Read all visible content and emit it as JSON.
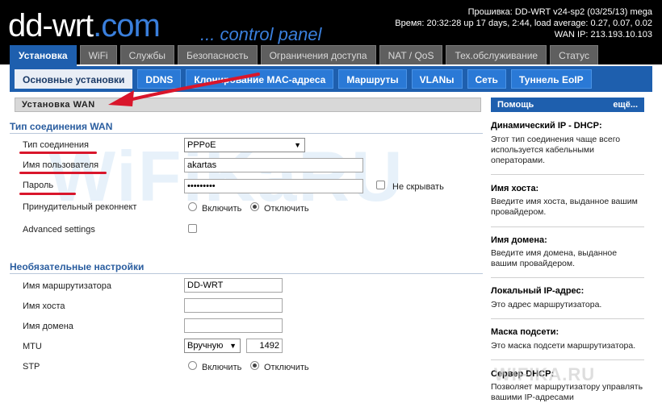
{
  "header": {
    "logo_main": "dd-wrt",
    "logo_dot": ".",
    "logo_tail": "com",
    "tagline": "... control panel",
    "firmware": "Прошивка: DD-WRT v24-sp2 (03/25/13) mega",
    "time": "Время: 20:32:28 up 17 days, 2:44, load average: 0.27, 0.07, 0.02",
    "wan_ip": "WAN IP: 213.193.10.103"
  },
  "tabs": [
    {
      "label": "Установка",
      "active": true
    },
    {
      "label": "WiFi"
    },
    {
      "label": "Службы"
    },
    {
      "label": "Безопасность"
    },
    {
      "label": "Ограничения доступа"
    },
    {
      "label": "NAT / QoS"
    },
    {
      "label": "Тех.обслуживание"
    },
    {
      "label": "Статус"
    }
  ],
  "subtabs": [
    {
      "label": "Основные установки",
      "active": true
    },
    {
      "label": "DDNS"
    },
    {
      "label": "Клонирование MAC-адреса"
    },
    {
      "label": "Маршруты"
    },
    {
      "label": "VLANы"
    },
    {
      "label": "Сеть"
    },
    {
      "label": "Туннель EoIP"
    }
  ],
  "section": {
    "title": "Установка WAN"
  },
  "wan": {
    "group_title": "Тип соединения WAN",
    "conn_type_label": "Тип соединения",
    "conn_type_value": "PPPoE",
    "username_label": "Имя пользователя",
    "username_value": "akartas",
    "password_label": "Пароль",
    "password_value": "•••••••••",
    "hide_label": "Не скрывать",
    "reconnect_label": "Принудительный реконнект",
    "enable_label": "Включить",
    "disable_label": "Отключить",
    "advanced_label": "Advanced settings"
  },
  "optional": {
    "group_title": "Необязательные настройки",
    "router_name_label": "Имя маршрутизатора",
    "router_name_value": "DD-WRT",
    "host_label": "Имя хоста",
    "host_value": "",
    "domain_label": "Имя домена",
    "domain_value": "",
    "mtu_label": "MTU",
    "mtu_mode": "Вручную",
    "mtu_value": "1492",
    "stp_label": "STP",
    "enable_label": "Включить",
    "disable_label": "Отключить"
  },
  "help": {
    "title": "Помощь",
    "more": "ещё...",
    "items": [
      {
        "title": "Динамический IP - DHCP:",
        "text": "Этот тип соединения чаще всего используется кабельными операторами."
      },
      {
        "title": "Имя хоста:",
        "text": "Введите имя хоста, выданное вашим провайдером."
      },
      {
        "title": "Имя домена:",
        "text": "Введите имя домена, выданное вашим провайдером."
      },
      {
        "title": "Локальный IP-адрес:",
        "text": "Это адрес маршрутизатора."
      },
      {
        "title": "Маска подсети:",
        "text": "Это маска подсети маршрутизатора."
      },
      {
        "title": "Сервер DHCP:",
        "text": "Позволяет маршрутизатору управлять вашими IP-адресами"
      }
    ]
  },
  "watermark": {
    "main": "WiFiKaRU",
    "corner": "WIFIKA.RU"
  },
  "colors": {
    "accent": "#1e5fae",
    "underline": "#d9162b",
    "header_bg": "#000000"
  }
}
